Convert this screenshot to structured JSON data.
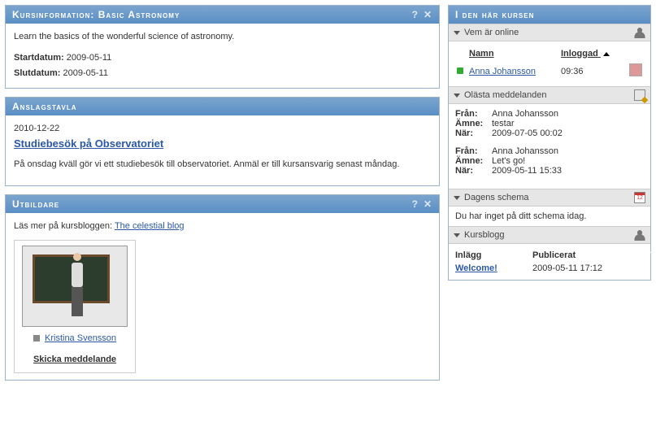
{
  "course_info": {
    "header": "Kursinformation: Basic Astronomy",
    "description": "Learn the basics of the wonderful science of astronomy.",
    "start_label": "Startdatum:",
    "start_value": "2009-05-11",
    "end_label": "Slutdatum:",
    "end_value": "2009-05-11"
  },
  "announcements": {
    "header": "Anslagstavla",
    "date": "2010-12-22",
    "title": "Studiebesök på Observatoriet",
    "body": "På onsdag kväll gör vi ett studiebesök till observatoriet. Anmäl er till kursansvarig senast måndag."
  },
  "educators": {
    "header": "Utbildare",
    "intro_prefix": "Läs mer på kursbloggen: ",
    "blog_link": "The celestial blog",
    "name": "Kristina Svensson",
    "send_msg": "Skicka meddelande"
  },
  "side": {
    "header": "I den här kursen",
    "online": {
      "title": "Vem är online",
      "col_name": "Namn",
      "col_login": "Inloggad",
      "user": "Anna Johansson",
      "time": "09:36"
    },
    "unread": {
      "title": "Olästa meddelanden",
      "from_label": "Från:",
      "subject_label": "Ämne:",
      "when_label": "När:",
      "messages": [
        {
          "from": "Anna Johansson",
          "subject": "testar",
          "when": "2009-07-05 00:02"
        },
        {
          "from": "Anna Johansson",
          "subject": "Let's go!",
          "when": "2009-05-11 15:33"
        }
      ]
    },
    "schedule": {
      "title": "Dagens schema",
      "empty": "Du har inget på ditt schema idag."
    },
    "blog": {
      "title": "Kursblogg",
      "col_post": "Inlägg",
      "col_pub": "Publicerat",
      "post_title": "Welcome!",
      "post_date": "2009-05-11 17:12"
    }
  }
}
